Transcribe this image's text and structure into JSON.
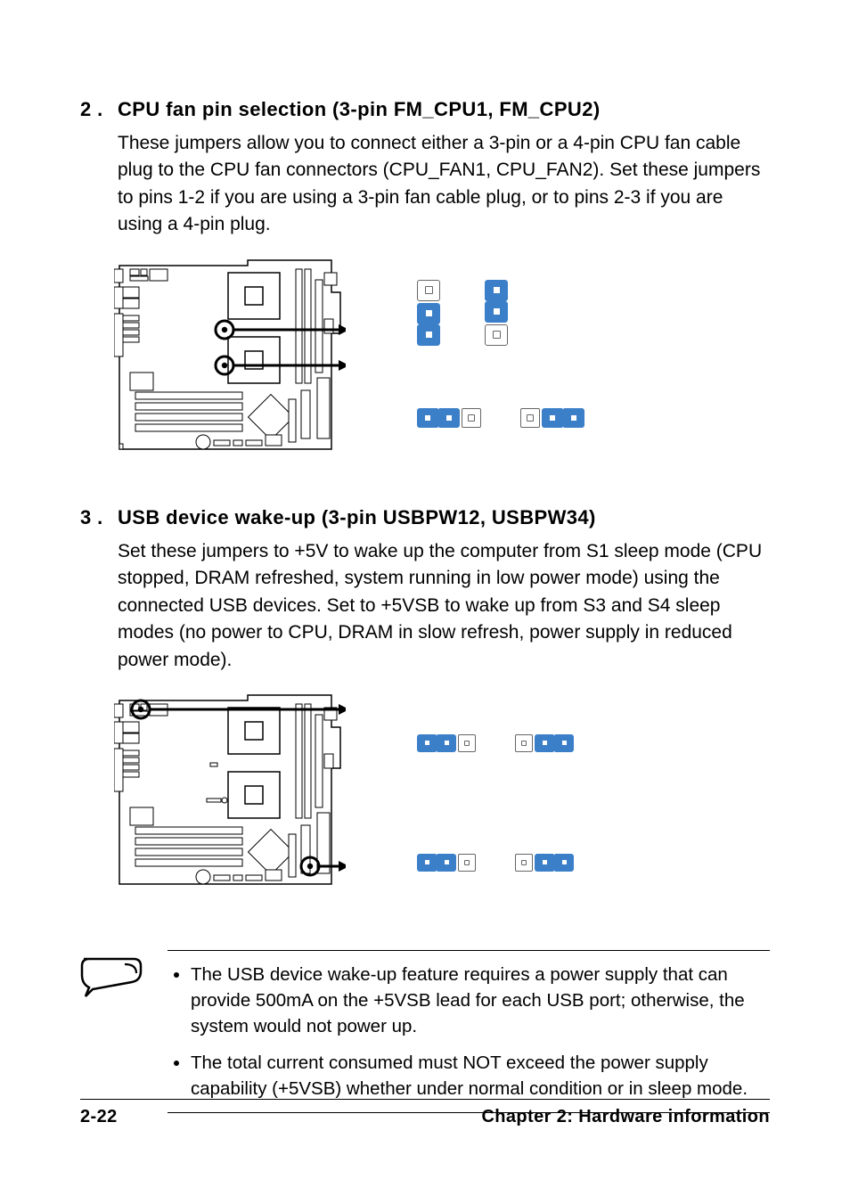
{
  "section2": {
    "num": "2 .",
    "title": "CPU fan pin selection (3-pin FM_CPU1, FM_CPU2)",
    "text": "These jumpers allow you to connect either a 3-pin or a 4-pin CPU fan cable plug to the CPU fan connectors (CPU_FAN1, CPU_FAN2). Set these jumpers to pins 1-2 if you are using a 3-pin fan cable plug, or to pins 2-3 if you are using a 4-pin plug."
  },
  "section3": {
    "num": "3 .",
    "title": "USB device wake-up (3-pin USBPW12, USBPW34)",
    "text": "Set these jumpers to +5V to wake up the computer from S1 sleep mode (CPU stopped, DRAM refreshed, system running in low power mode) using the connected USB devices. Set to +5VSB to wake up from S3 and S4 sleep modes (no power to CPU, DRAM in slow refresh, power supply in reduced power mode)."
  },
  "notes": {
    "bullet1": "The USB device wake-up feature requires a power supply that can provide 500mA on the +5VSB lead for each USB port; otherwise, the system would not power up.",
    "bullet2": "The total current consumed must NOT exceed the power supply capability (+5VSB) whether under normal condition or in sleep mode."
  },
  "footer": {
    "left": "2-22",
    "right": "Chapter 2: Hardware information"
  }
}
